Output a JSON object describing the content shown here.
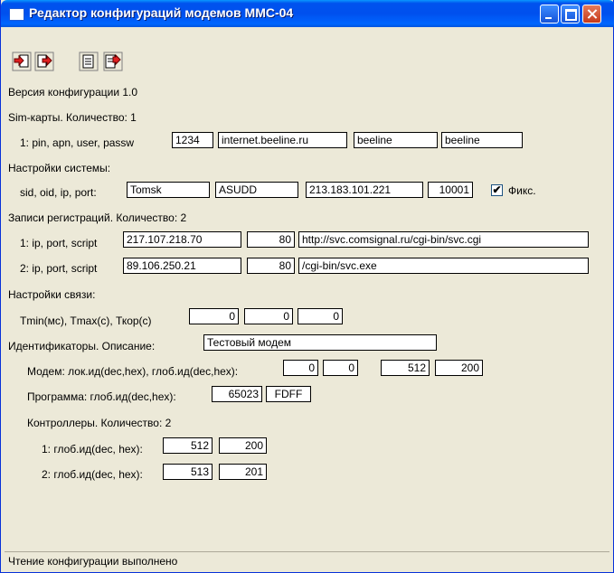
{
  "window": {
    "title": "Редактор конфигураций модемов ММС-04"
  },
  "toolbar": {
    "buttons": [
      "open-config-icon",
      "read-config-icon",
      "save-config-icon",
      "write-config-icon"
    ]
  },
  "config_version": "Версия конфигурации 1.0",
  "sim": {
    "header": "Sim-карты. Количество: 1",
    "row_label": "1: pin, apn, user, passw",
    "pin": "1234",
    "apn": "internet.beeline.ru",
    "user": "beeline",
    "password": "beeline"
  },
  "system": {
    "header": "Настройки системы:",
    "row_label": "sid, oid, ip, port:",
    "sid": "Tomsk",
    "oid": "ASUDD",
    "ip": "213.183.101.221",
    "port": "10001",
    "fixed_label": "Фикс.",
    "fixed_checked": true,
    "check_mark": "✔"
  },
  "registrations": {
    "header": "Записи регистраций. Количество: 2",
    "rows": [
      {
        "label": "1: ip, port, script",
        "ip": "217.107.218.70",
        "port": "80",
        "script": "http://svc.comsignal.ru/cgi-bin/svc.cgi"
      },
      {
        "label": "2: ip, port, script",
        "ip": "89.106.250.21",
        "port": "80",
        "script": "/cgi-bin/svc.exe"
      }
    ]
  },
  "connection": {
    "header": "Настройки связи:",
    "row_label": "Tmin(мс), Tmax(с), Ткор(с)",
    "tmin": "0",
    "tmax": "0",
    "tkor": "0"
  },
  "identifiers": {
    "label": "Идентификаторы. Описание:",
    "description": "Тестовый модем",
    "modem_label": "Модем: лок.ид(dec,hex), глоб.ид(dec,hex):",
    "modem_local_dec": "0",
    "modem_local_hex": "0",
    "modem_global_dec": "512",
    "modem_global_hex": "200",
    "program_label": "Программа: глоб.ид(dec,hex):",
    "program_global_dec": "65023",
    "program_global_hex": "FDFF"
  },
  "controllers": {
    "header": "Контроллеры. Количество: 2",
    "rows": [
      {
        "label": "1: глоб.ид(dec, hex):",
        "dec": "512",
        "hex": "200"
      },
      {
        "label": "2: глоб.ид(dec, hex):",
        "dec": "513",
        "hex": "201"
      }
    ]
  },
  "status": {
    "text": "Чтение конфигурации выполнено"
  }
}
